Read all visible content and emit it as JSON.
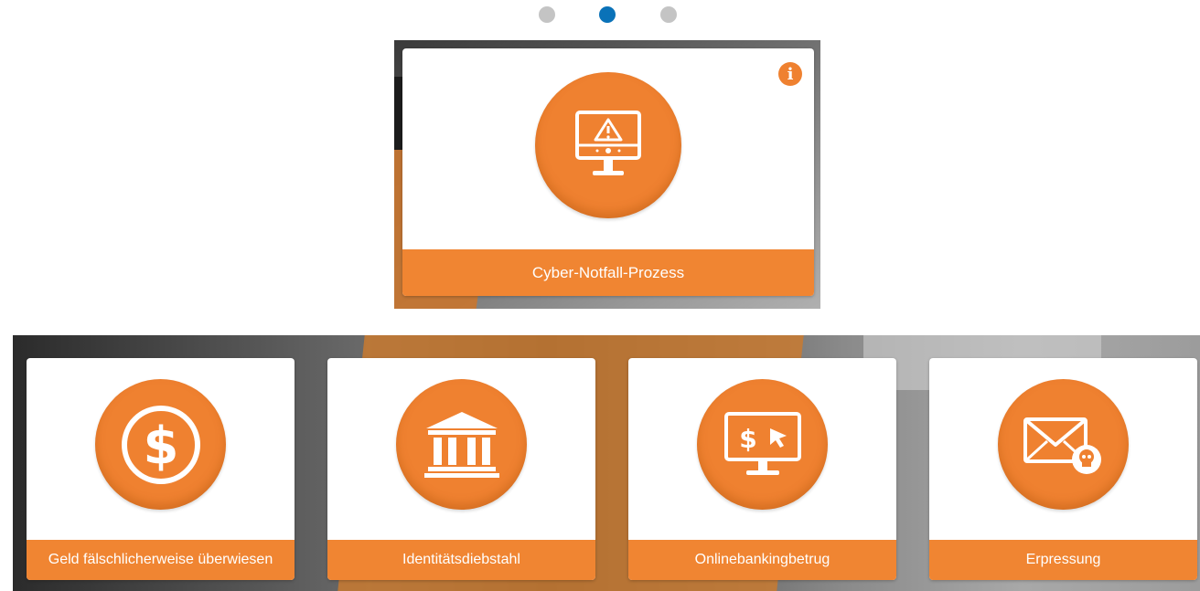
{
  "carousel": {
    "dots": [
      {
        "label": "slide-1",
        "active": false
      },
      {
        "label": "slide-2",
        "active": true
      },
      {
        "label": "slide-3",
        "active": false
      }
    ]
  },
  "hero": {
    "title": "Cyber-Notfall-Prozess",
    "icon": "monitor-warning-icon",
    "info_glyph": "i"
  },
  "tiles": [
    {
      "title": "Geld fälschlicherweise überwiesen",
      "icon": "dollar-icon"
    },
    {
      "title": "Identitätsdiebstahl",
      "icon": "bank-icon"
    },
    {
      "title": "Onlinebankingbetrug",
      "icon": "monitor-dollar-icon"
    },
    {
      "title": "Erpressung",
      "icon": "mail-skull-icon"
    }
  ],
  "colors": {
    "accent": "#ef8130",
    "label_bar": "#f08532",
    "dot_active": "#0a72b8",
    "dot_inactive": "#c4c4c4"
  }
}
